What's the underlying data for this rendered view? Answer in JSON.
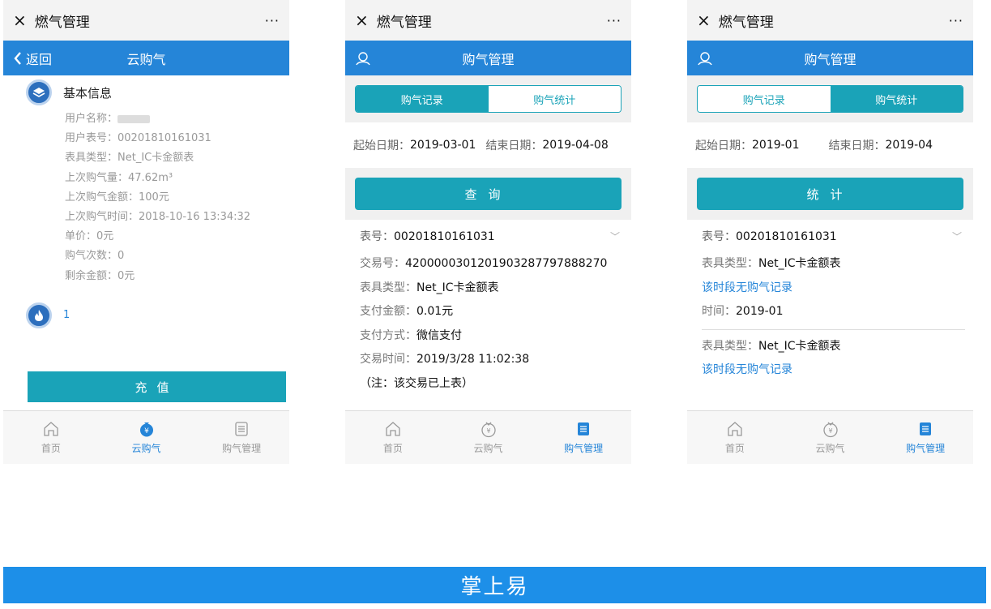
{
  "wechat": {
    "title": "燃气管理",
    "more": "···",
    "close": "×"
  },
  "phone1": {
    "nav": {
      "back": "返回",
      "title": "云购气"
    },
    "section_title": "基本信息",
    "user_name_label": "用户名称：",
    "user_meter": "用户表号：00201810161031",
    "meter_type": "表具类型：Net_IC卡金额表",
    "last_volume": "上次购气量：47.62m³",
    "last_amount": "上次购气金额：100元",
    "last_time": "上次购气时间：2018-10-16 13:34:32",
    "unit_price": "单价：0元",
    "purchase_count": "购气次数：0",
    "balance": "剩余金额：0元",
    "second_value": "1",
    "recharge": "充值"
  },
  "phone2": {
    "nav_title": "购气管理",
    "tab_records": "购气记录",
    "tab_stats": "购气统计",
    "start_label": "起始日期：",
    "start_value": "2019-03-01",
    "end_label": "结束日期：",
    "end_value": "2019-04-08",
    "query": "查询",
    "meter_label": "表号：",
    "meter_value": "00201810161031",
    "rows": [
      {
        "k": "交易号：",
        "v": "4200000301201903287797888270"
      },
      {
        "k": "表具类型：",
        "v": "Net_IC卡金额表"
      },
      {
        "k": "支付金额：",
        "v": "0.01元"
      },
      {
        "k": "支付方式：",
        "v": "微信支付"
      },
      {
        "k": "交易时间：",
        "v": "2019/3/28 11:02:38"
      }
    ],
    "note": "（注：该交易已上表）"
  },
  "phone3": {
    "nav_title": "购气管理",
    "tab_records": "购气记录",
    "tab_stats": "购气统计",
    "start_label": "起始日期：",
    "start_value": "2019-01",
    "end_label": "结束日期：",
    "end_value": "2019-04",
    "stat": "统计",
    "meter_label": "表号：",
    "meter_value": "00201810161031",
    "type_label": "表具类型：",
    "type_value": "Net_IC卡金额表",
    "no_record": "该时段无购气记录",
    "time_label": "时间：",
    "time_value": "2019-01"
  },
  "tabs": {
    "home": "首页",
    "cloud": "云购气",
    "manage": "购气管理"
  },
  "footer": "掌上易",
  "colors": {
    "nav_blue": "#2585d8",
    "teal": "#1aa3b8",
    "footer_blue": "#1d8fe8"
  }
}
